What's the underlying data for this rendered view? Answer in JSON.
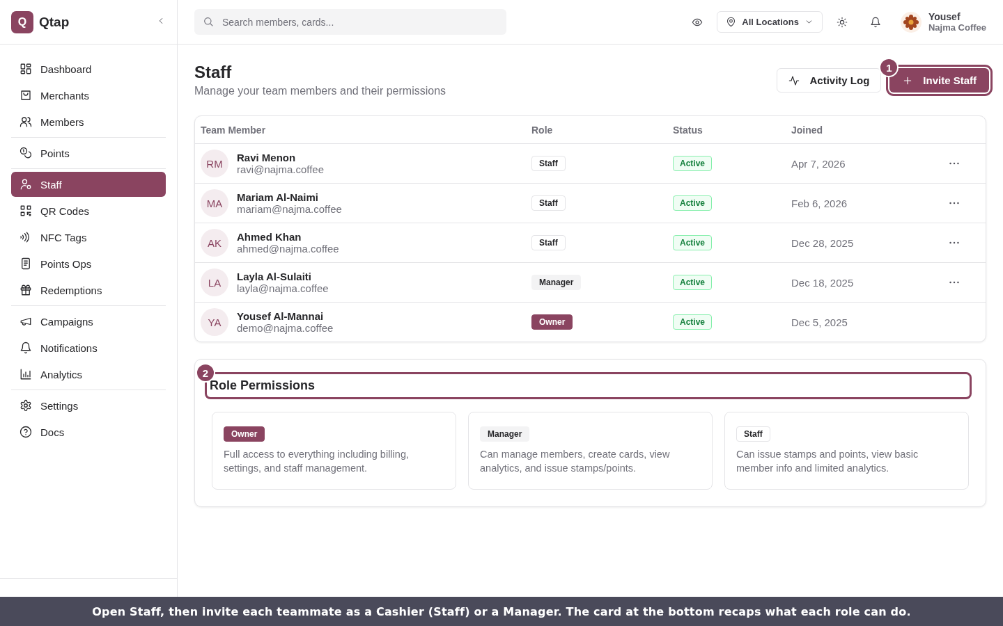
{
  "sidebar": {
    "brand": {
      "logo_letter": "Q",
      "name": "Qtap"
    },
    "groups": [
      [
        {
          "label": "Dashboard",
          "selected": false
        },
        {
          "label": "Merchants",
          "selected": false
        },
        {
          "label": "Members",
          "selected": false
        }
      ],
      [
        {
          "label": "Points",
          "selected": false
        }
      ],
      [
        {
          "label": "Staff",
          "selected": true
        },
        {
          "label": "QR Codes",
          "selected": false
        },
        {
          "label": "NFC Tags",
          "selected": false
        },
        {
          "label": "Points Ops",
          "selected": false
        },
        {
          "label": "Redemptions",
          "selected": false
        }
      ],
      [
        {
          "label": "Campaigns",
          "selected": false
        },
        {
          "label": "Notifications",
          "selected": false
        },
        {
          "label": "Analytics",
          "selected": false
        }
      ],
      [
        {
          "label": "Settings",
          "selected": false
        },
        {
          "label": "Docs",
          "selected": false
        }
      ]
    ]
  },
  "topbar": {
    "search": {
      "placeholder": "Search members, cards..."
    },
    "location": "All Locations",
    "user": {
      "name": "Yousef",
      "business": "Najma Coffee"
    }
  },
  "page": {
    "title": "Staff",
    "subtitle": "Manage your team members and their permissions",
    "actions": [
      {
        "label": "Activity Log",
        "kind": "secondary"
      },
      {
        "label": "Invite Staff",
        "kind": "primary",
        "callout": "1"
      }
    ]
  },
  "table": {
    "columns": [
      "Team Member",
      "Role",
      "Status",
      "Joined"
    ],
    "rows": [
      {
        "initials": "RM",
        "name": "Ravi Menon",
        "email": "ravi@najma.coffee",
        "role": {
          "label": "Staff",
          "kind": "staff"
        },
        "status": "Active",
        "joined": "Apr 7, 2026",
        "has_menu": true
      },
      {
        "initials": "MA",
        "name": "Mariam Al-Naimi",
        "email": "mariam@najma.coffee",
        "role": {
          "label": "Staff",
          "kind": "staff"
        },
        "status": "Active",
        "joined": "Feb 6, 2026",
        "has_menu": true
      },
      {
        "initials": "AK",
        "name": "Ahmed Khan",
        "email": "ahmed@najma.coffee",
        "role": {
          "label": "Staff",
          "kind": "staff"
        },
        "status": "Active",
        "joined": "Dec 28, 2025",
        "has_menu": true
      },
      {
        "initials": "LA",
        "name": "Layla Al-Sulaiti",
        "email": "layla@najma.coffee",
        "role": {
          "label": "Manager",
          "kind": "manager"
        },
        "status": "Active",
        "joined": "Dec 18, 2025",
        "has_menu": true
      },
      {
        "initials": "YA",
        "name": "Yousef Al-Mannai",
        "email": "demo@najma.coffee",
        "role": {
          "label": "Owner",
          "kind": "owner"
        },
        "status": "Active",
        "joined": "Dec 5, 2025",
        "has_menu": false
      }
    ]
  },
  "role_permissions": {
    "title": "Role Permissions",
    "callout": "2",
    "roles": [
      {
        "label": "Owner",
        "kind": "owner",
        "description": "Full access to everything including billing, settings, and staff management."
      },
      {
        "label": "Manager",
        "kind": "manager",
        "description": "Can manage members, create cards, view analytics, and issue stamps/points."
      },
      {
        "label": "Staff",
        "kind": "staff",
        "description": "Can issue stamps and points, view basic member info and limited analytics."
      }
    ]
  },
  "caption": "Open Staff, then invite each teammate as a Cashier (Staff) or a Manager. The card at the bottom recaps what each role can do."
}
